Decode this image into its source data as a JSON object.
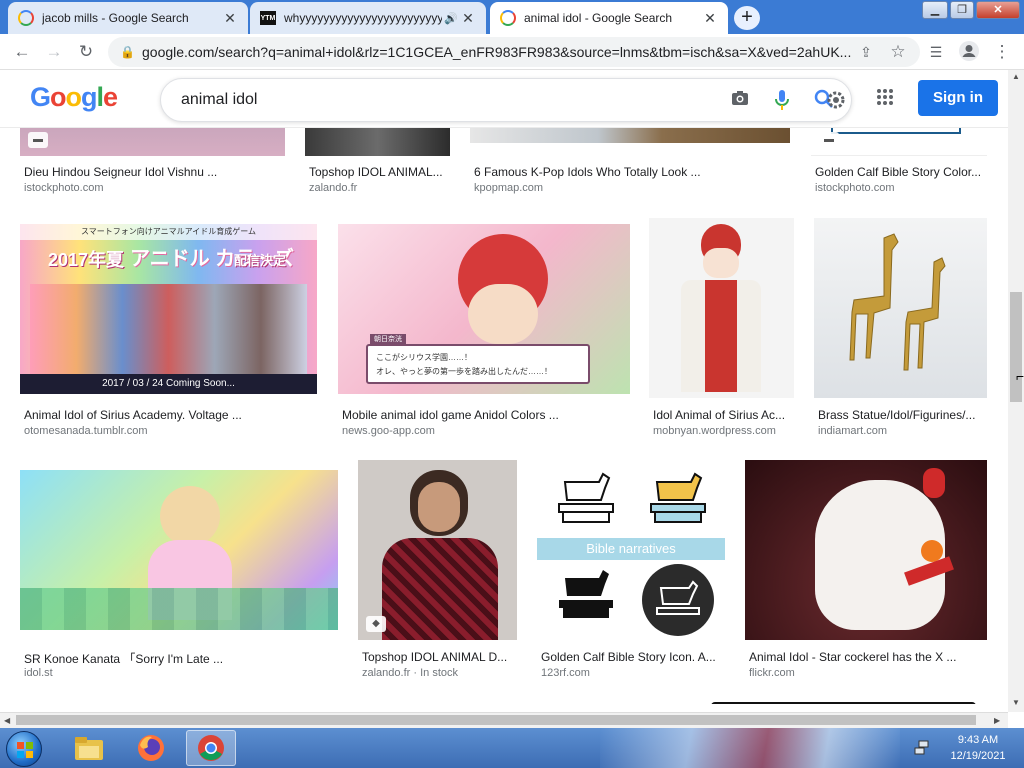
{
  "tabs": [
    {
      "title": "jacob mills - Google Search",
      "favicon": "google-icon",
      "active": false
    },
    {
      "title": "whyyyyyyyyyyyyyyyyyyyyyyyy",
      "favicon": "youtube-music-icon",
      "active": false
    },
    {
      "title": "animal idol - Google Search",
      "favicon": "google-icon",
      "active": true
    }
  ],
  "youtube_music_favicon_text": "YTM",
  "new_tab_symbol": "+",
  "address_bar": {
    "url": "google.com/search?q=animal+idol&rlz=1C1GCEA_enFR983FR983&source=lnms&tbm=isch&sa=X&ved=2ahUK..."
  },
  "google": {
    "logo": "Google",
    "search_query": "animal idol",
    "signin_label": "Sign in"
  },
  "results_top_row": [
    {
      "caption": "Dieu Hindou Seigneur Idol Vishnu ...",
      "source": "istockphoto.com"
    },
    {
      "caption": "Topshop IDOL ANIMAL...",
      "source": "zalando.fr"
    },
    {
      "caption": "6 Famous K-Pop Idols Who Totally Look ...",
      "source": "kpopmap.com"
    },
    {
      "caption": "Golden Calf Bible Story Color...",
      "source": "istockphoto.com"
    }
  ],
  "results_row2": [
    {
      "caption": "Animal Idol of Sirius Academy. Voltage ...",
      "source": "otomesanada.tumblr.com",
      "img_text_top": "スマートフォン向けアニマルアイドル育成ゲーム",
      "img_text_year": "2017年夏",
      "img_text_title": "アニドル カラーズ",
      "img_text_release": "配信決定",
      "img_text_date": "2017 / 03 / 24 Coming Soon...",
      "color": "#e76aa6"
    },
    {
      "caption": "Mobile animal idol game Anidol Colors ...",
      "source": "news.goo-app.com",
      "img_text_name": "朝日奈洸",
      "img_text_line1": "ここがシリウス学園……！",
      "img_text_line2": "オレ、やっと夢の第一歩を踏み出したんだ……！",
      "color": "#f3c6d6"
    },
    {
      "caption": "Idol Animal of Sirius Ac...",
      "source": "mobnyan.wordpress.com",
      "color": "#f4f4f4"
    },
    {
      "caption": "Brass Statue/Idol/Figurines/...",
      "source": "indiamart.com",
      "color": "#e9ecef"
    }
  ],
  "results_row3": [
    {
      "caption": "SR Konoe Kanata 「Sorry I'm Late ...",
      "source": "idol.st",
      "color": "#7fd3f0"
    },
    {
      "caption": "Topshop IDOL ANIMAL D...",
      "source": "zalando.fr · In stock",
      "color": "#c7c3c0"
    },
    {
      "caption": "Golden Calf Bible Story Icon. A...",
      "source": "123rf.com",
      "banner": "Bible narratives",
      "color": "#ffffff"
    },
    {
      "caption": "Animal Idol - Star cockerel has the X ...",
      "source": "flickr.com",
      "color": "#5a1e22"
    }
  ],
  "clock": {
    "time": "9:43 AM",
    "date": "12/19/2021"
  }
}
